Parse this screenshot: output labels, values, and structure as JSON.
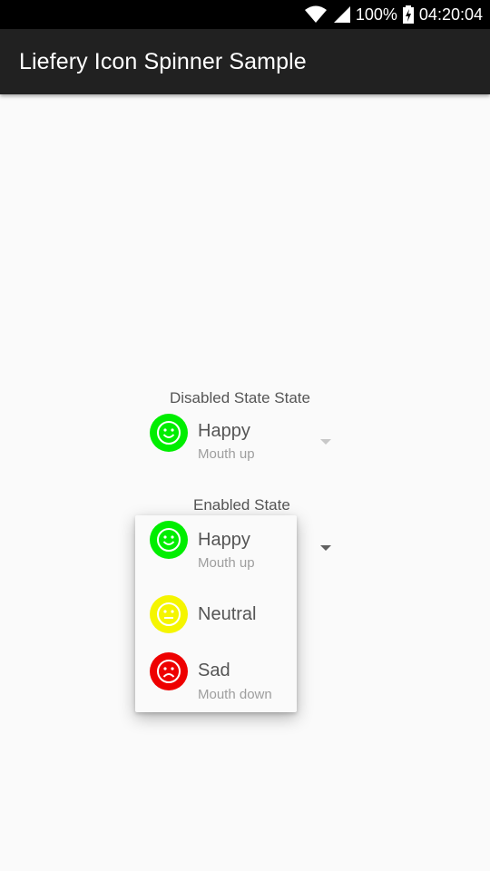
{
  "status_bar": {
    "battery": "100%",
    "time": "04:20:04",
    "icons": [
      "wifi-icon",
      "cellular-signal-icon",
      "battery-charging-icon"
    ]
  },
  "app_bar": {
    "title": "Liefery Icon Spinner Sample"
  },
  "disabled_spinner": {
    "label": "Disabled State State",
    "selected": {
      "title": "Happy",
      "subtitle": "Mouth up",
      "icon": "happy-face-icon",
      "color": "#00ee00"
    }
  },
  "enabled_spinner": {
    "label": "Enabled State",
    "options": [
      {
        "title": "Happy",
        "subtitle": "Mouth up",
        "icon": "happy-face-icon",
        "color": "#00ee00"
      },
      {
        "title": "Neutral",
        "subtitle": "",
        "icon": "neutral-face-icon",
        "color": "#f5f500"
      },
      {
        "title": "Sad",
        "subtitle": "Mouth down",
        "icon": "sad-face-icon",
        "color": "#ee0000"
      }
    ]
  },
  "colors": {
    "app_bar": "#212121",
    "background": "#fafafa",
    "happy": "#00ee00",
    "neutral": "#f5f500",
    "sad": "#ee0000"
  }
}
